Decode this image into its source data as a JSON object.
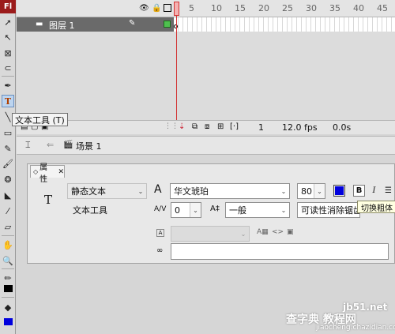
{
  "app": {
    "logo_text": "Fl"
  },
  "tools_tooltip": "文本工具 (T)",
  "timeline": {
    "ruler_numbers": [
      "5",
      "10",
      "15",
      "20",
      "25",
      "30",
      "35",
      "40",
      "45"
    ],
    "layer_name": "图层 1",
    "current_frame": "1",
    "fps": "12.0 fps",
    "elapsed": "0.0s"
  },
  "scene": {
    "label": "场景 1"
  },
  "properties": {
    "tab_label": "属性",
    "tool_name": "文本工具",
    "text_type": "静态文本",
    "font_family": "华文琥珀",
    "font_size": "80",
    "letter_spacing": "0",
    "baseline": "一般",
    "anti_alias": "可读性消除锯齿",
    "bold_label": "B",
    "italic_label": "I",
    "link_value": ""
  },
  "bold_tooltip": "切换粗体",
  "colors": {
    "text_color": "#0000dd",
    "accent": "#9b1b1b"
  },
  "watermark": {
    "site": "jb51.net",
    "line": "查字典 教程网",
    "url": "jiaocheng.chazidian.com"
  }
}
